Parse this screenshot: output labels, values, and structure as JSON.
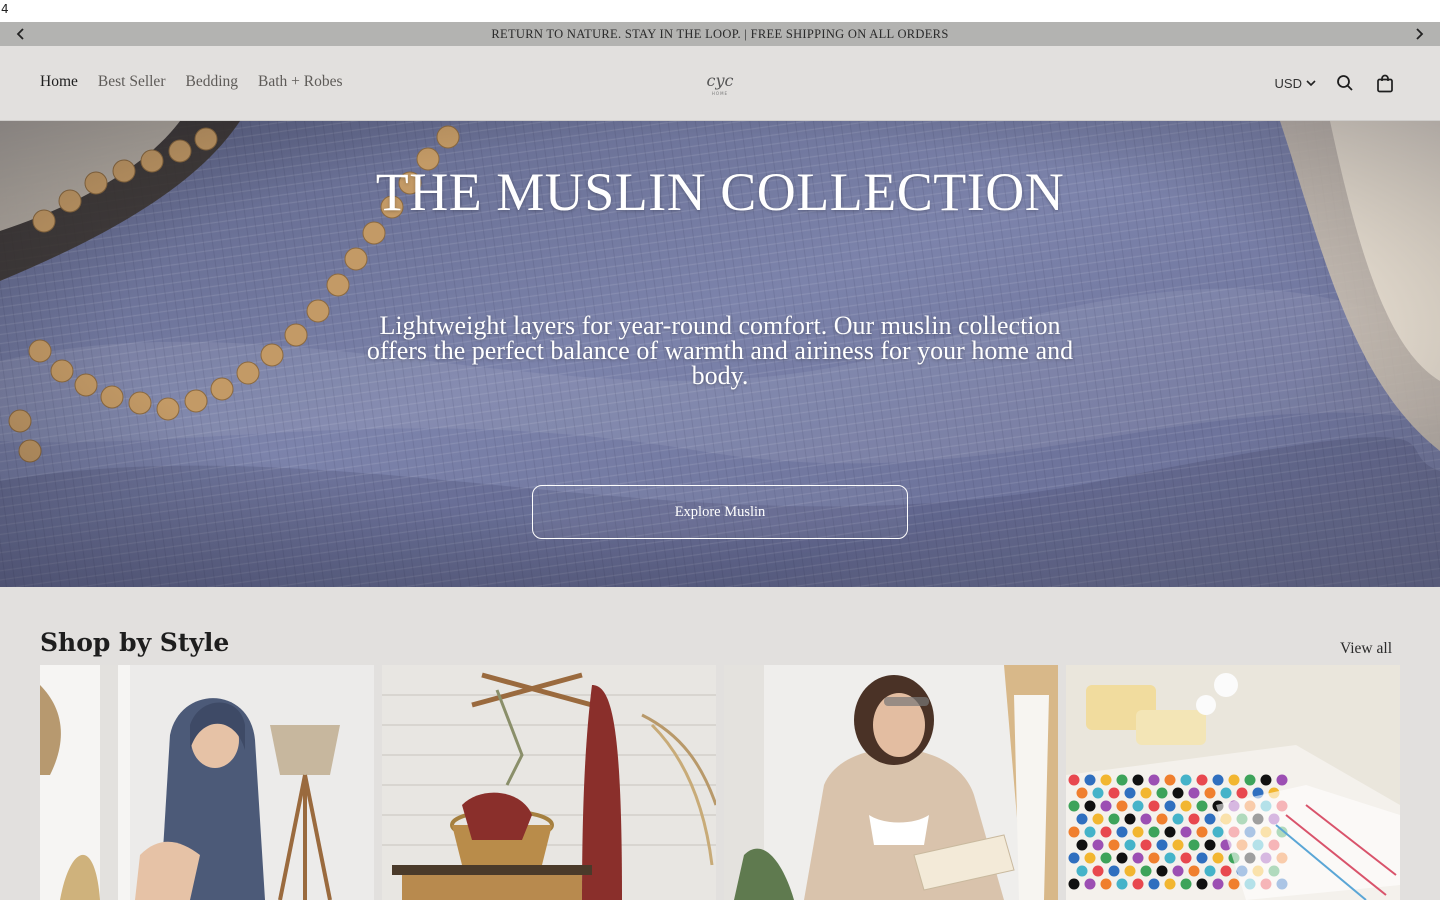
{
  "page_marker": "4",
  "announcement": {
    "text": "RETURN TO NATURE. STAY IN THE LOOP. | FREE SHIPPING ON ALL ORDERS",
    "prev_icon": "chevron-left-icon",
    "next_icon": "chevron-right-icon"
  },
  "nav": {
    "items": [
      "Home",
      "Best Seller",
      "Bedding",
      "Bath + Robes"
    ],
    "active": "Home"
  },
  "logo": {
    "script": "cyc",
    "tagline": "HOME"
  },
  "header_utils": {
    "currency": "USD",
    "search_icon": "search-icon",
    "cart_icon": "bag-icon"
  },
  "hero": {
    "title": "THE MUSLIN COLLECTION",
    "subtitle": "Lightweight layers for year-round comfort. Our muslin collection offers the perfect balance of warmth and airiness for your home and body.",
    "cta_label": "Explore Muslin"
  },
  "collection": {
    "title": "Shop by Style",
    "view_all_label": "View all",
    "cards": [
      {
        "image": "woman-in-navy-waffle-hooded-robe"
      },
      {
        "image": "red-waffle-towel-on-wall-hook-and-basket"
      },
      {
        "image": "woman-in-beige-muslin-robe-reading"
      },
      {
        "image": "colorful-pompom-towels-with-soap"
      }
    ]
  },
  "colors": {
    "page_bg": "#e2e0de",
    "announcement_bg": "#b3b3b1",
    "hero_fabric": "#7077a0",
    "text": "#1e1e1e"
  }
}
